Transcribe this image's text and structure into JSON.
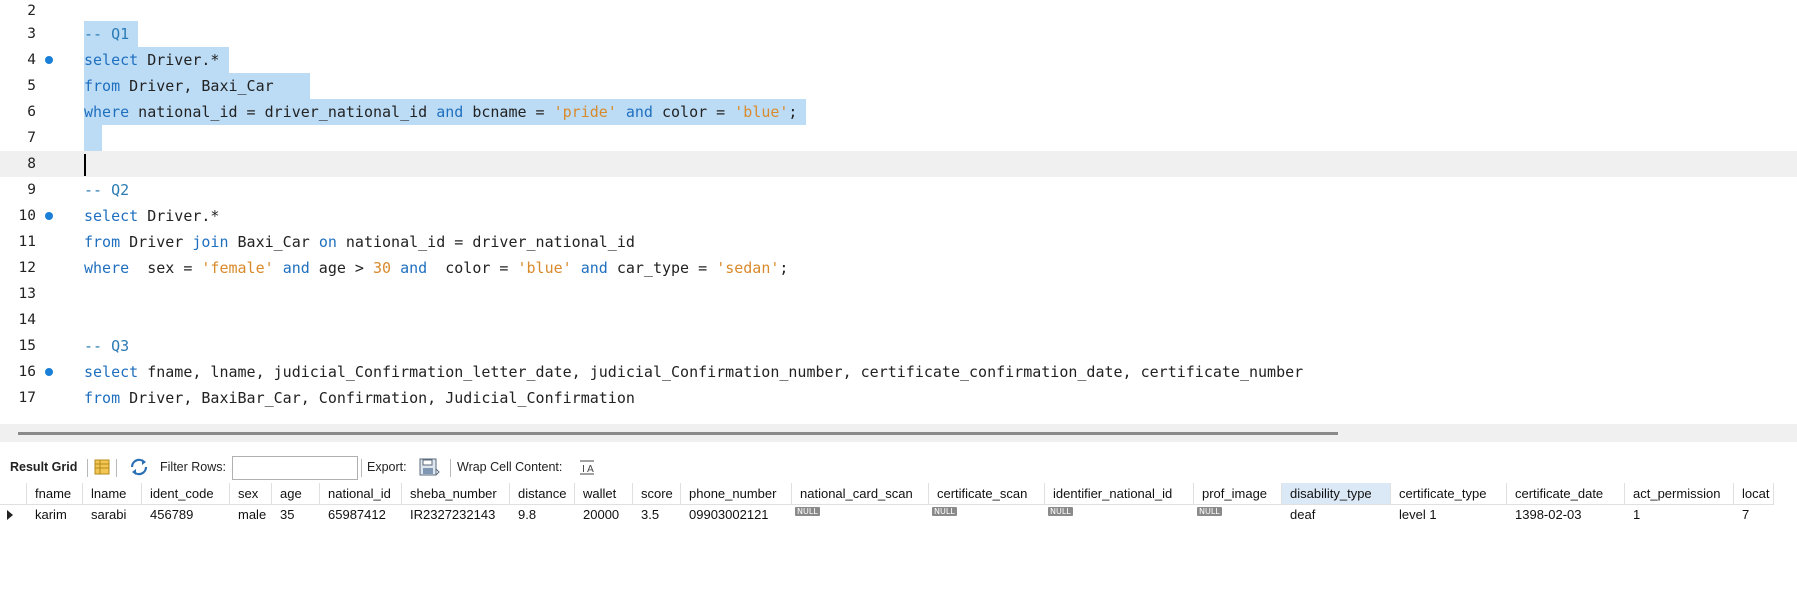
{
  "editor": {
    "lines": [
      {
        "n": "2",
        "dot": false
      },
      {
        "n": "3",
        "dot": false
      },
      {
        "n": "4",
        "dot": true
      },
      {
        "n": "5",
        "dot": false
      },
      {
        "n": "6",
        "dot": false
      },
      {
        "n": "7",
        "dot": false
      },
      {
        "n": "8",
        "dot": false
      },
      {
        "n": "9",
        "dot": false
      },
      {
        "n": "10",
        "dot": true
      },
      {
        "n": "11",
        "dot": false
      },
      {
        "n": "12",
        "dot": false
      },
      {
        "n": "13",
        "dot": false
      },
      {
        "n": "14",
        "dot": false
      },
      {
        "n": "15",
        "dot": false
      },
      {
        "n": "16",
        "dot": true
      },
      {
        "n": "17",
        "dot": false
      }
    ],
    "q1_comment": "-- Q1",
    "q1_select": "select",
    "q1_select_rest": " Driver.*",
    "q1_from": "from",
    "q1_from_rest": " Driver, Baxi_Car",
    "q1_where": "where",
    "q1_where_a": " national_id = driver_national_id ",
    "and": "and",
    "q1_where_b": " bcname = ",
    "q1_str_pride": "'pride'",
    "q1_where_c": " color = ",
    "str_blue": "'blue'",
    "semicolon": ";",
    "q2_comment": "-- Q2",
    "q2_select": "select",
    "q2_select_rest": " Driver.*",
    "q2_from": "from",
    "q2_from_a": " Driver ",
    "q2_join": "join",
    "q2_from_b": " Baxi_Car ",
    "q2_on": "on",
    "q2_from_c": " national_id = driver_national_id",
    "q2_where": "where",
    "q2_where_a": "  sex = ",
    "q2_str_female": "'female'",
    "q2_where_b": " age > ",
    "q2_num_30": "30",
    "q2_where_c": "  color = ",
    "q2_where_d": " car_type = ",
    "q2_str_sedan": "'sedan'",
    "q3_comment": "-- Q3",
    "q3_select": "select",
    "q3_select_rest": " fname, lname, judicial_Confirmation_letter_date, judicial_Confirmation_number, certificate_confirmation_date, certificate_number",
    "q3_from": "from",
    "q3_from_rest": " Driver, BaxiBar_Car, Confirmation, Judicial_Confirmation"
  },
  "toolbar": {
    "result_grid": "Result Grid",
    "filter_rows": "Filter Rows:",
    "filter_value": "",
    "export": "Export:",
    "wrap_cell": "Wrap Cell Content:"
  },
  "grid": {
    "columns": [
      "fname",
      "lname",
      "ident_code",
      "sex",
      "age",
      "national_id",
      "sheba_number",
      "distance",
      "wallet",
      "score",
      "phone_number",
      "national_card_scan",
      "certificate_scan",
      "identifier_national_id",
      "prof_image",
      "disability_type",
      "certificate_type",
      "certificate_date",
      "act_permission",
      "locat"
    ],
    "row": [
      "karim",
      "sarabi",
      "456789",
      "male",
      "35",
      "65987412",
      "IR2327232143",
      "9.8",
      "20000",
      "3.5",
      "09903002121",
      "NULL",
      "NULL",
      "NULL",
      "NULL",
      "deaf",
      "level 1",
      "1398-02-03",
      "1",
      "7"
    ],
    "highlighted_column": "disability_type"
  },
  "colors": {
    "keyword": "#1f6fbf",
    "string": "#d98a2b",
    "selection": "#bcdcf6",
    "breakpoint_dot": "#1a7fd6"
  }
}
